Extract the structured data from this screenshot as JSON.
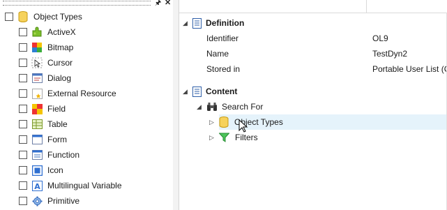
{
  "left_panel": {
    "root": {
      "label": "Object Types",
      "icon": "object-types-cylinder-icon"
    },
    "items": [
      {
        "label": "ActiveX",
        "icon": "puzzle-icon"
      },
      {
        "label": "Bitmap",
        "icon": "bitmap-icon"
      },
      {
        "label": "Cursor",
        "icon": "cursor-icon"
      },
      {
        "label": "Dialog",
        "icon": "dialog-icon"
      },
      {
        "label": "External Resource",
        "icon": "external-resource-icon"
      },
      {
        "label": "Field",
        "icon": "field-icon"
      },
      {
        "label": "Table",
        "icon": "table-icon"
      },
      {
        "label": "Form",
        "icon": "form-icon"
      },
      {
        "label": "Function",
        "icon": "function-icon"
      },
      {
        "label": "Icon",
        "icon": "icon-icon"
      },
      {
        "label": "Multilingual Variable",
        "icon": "multilingual-variable-icon"
      },
      {
        "label": "Primitive",
        "icon": "gear-icon"
      }
    ]
  },
  "right_panel": {
    "definition": {
      "title": "Definition",
      "properties": [
        {
          "name": "Identifier",
          "value": "OL9"
        },
        {
          "name": "Name",
          "value": "TestDyn2"
        },
        {
          "name": "Stored in",
          "value": "Portable User List (C"
        }
      ]
    },
    "content": {
      "title": "Content",
      "search_for": "Search For",
      "children": [
        {
          "label": "Object Types"
        },
        {
          "label": "Filters"
        }
      ]
    }
  },
  "colors": {
    "highlight": "#e5f3fb",
    "accent": "#2b7bd6"
  }
}
